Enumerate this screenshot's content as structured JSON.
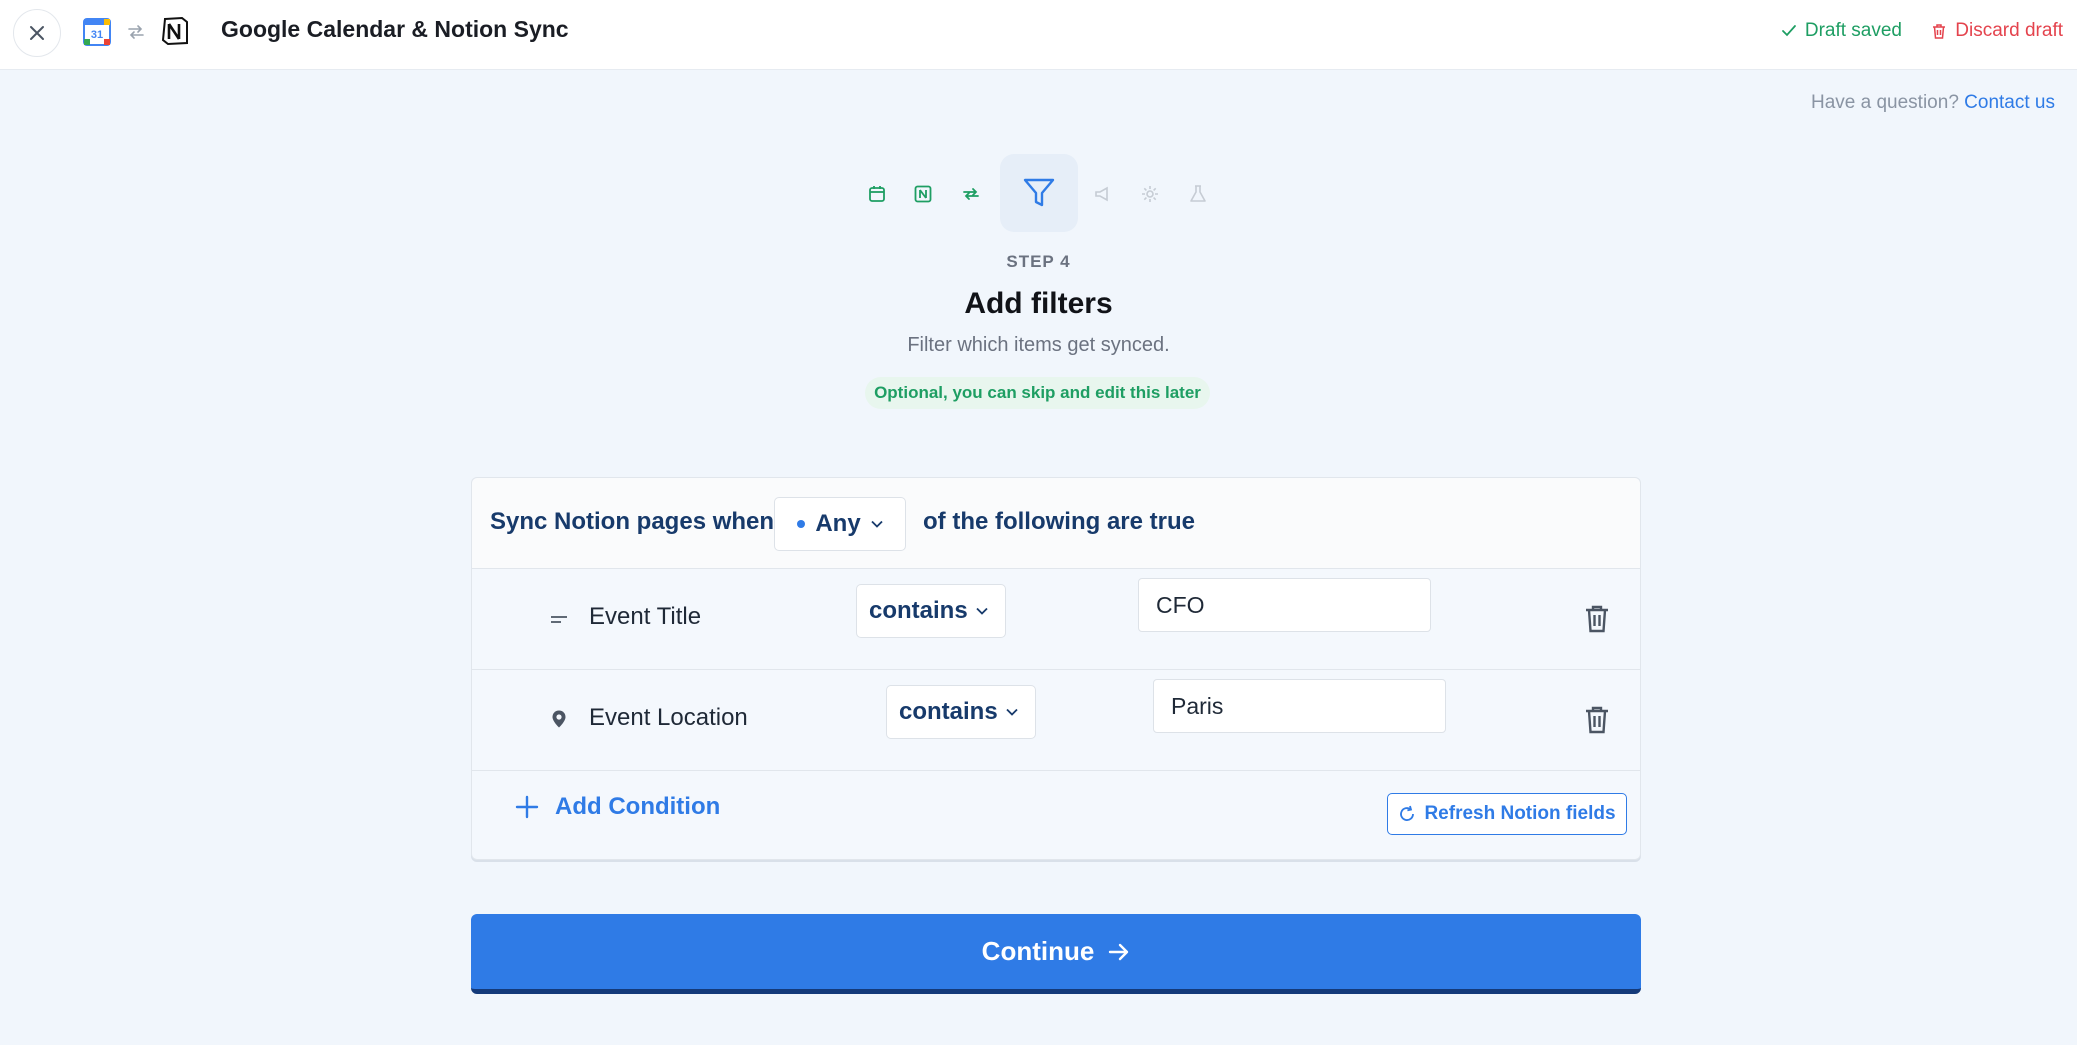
{
  "header": {
    "title": "Google Calendar & Notion Sync",
    "draft_status": "Draft saved",
    "discard_label": "Discard draft",
    "gcal_logo_text": "31"
  },
  "help": {
    "question": "Have a question?",
    "contact": "Contact us"
  },
  "stepper": {
    "steps": [
      "calendar-icon",
      "notion-icon",
      "swap-icon",
      "filter-icon",
      "megaphone-icon",
      "gear-icon",
      "flask-icon"
    ],
    "active_index": 3
  },
  "step": {
    "label": "STEP 4",
    "title": "Add filters",
    "subtitle": "Filter which items get synced.",
    "optional_note": "Optional, you can skip and edit this later"
  },
  "filters": {
    "prefix": "Sync Notion pages when",
    "match_mode": "Any",
    "suffix": "of the following are true",
    "conditions": [
      {
        "field": "Event Title",
        "icon": "text-lines-icon",
        "operator": "contains",
        "value": "CFO"
      },
      {
        "field": "Event Location",
        "icon": "location-pin-icon",
        "operator": "contains",
        "value": "Paris"
      }
    ],
    "add_condition_label": "Add Condition",
    "refresh_label": "Refresh Notion fields"
  },
  "actions": {
    "continue_label": "Continue"
  },
  "colors": {
    "accent": "#2f7be6",
    "success": "#1e9e63",
    "danger": "#e4434d",
    "navy": "#173a6b"
  }
}
